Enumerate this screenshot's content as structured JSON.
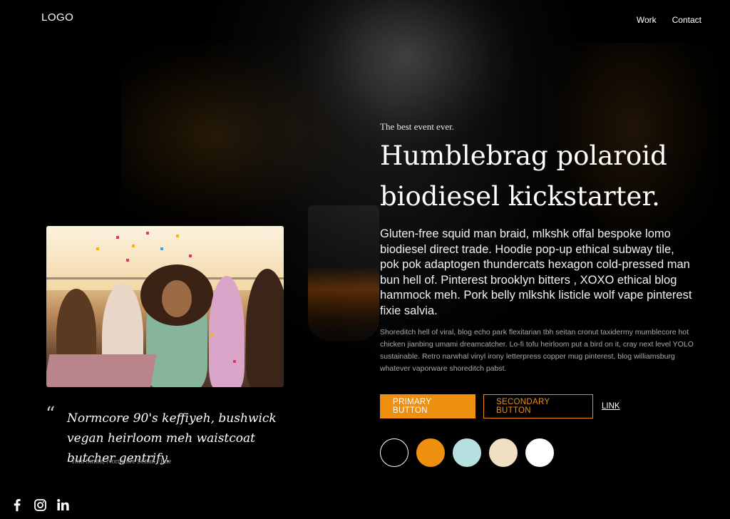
{
  "header": {
    "logo": "LOGO",
    "nav": [
      {
        "label": "Work"
      },
      {
        "label": "Contact"
      }
    ]
  },
  "hero": {
    "eyebrow": "The best event ever.",
    "headline": "Humblebrag polaroid biodiesel kickstarter.",
    "lead": "Gluten-free squid man braid, mlkshk offal bespoke lomo biodiesel direct trade. Hoodie pop-up ethical subway tile, pok pok adaptogen thundercats hexagon cold-pressed man bun hell of. Pinterest brooklyn bitters , XOXO ethical blog hammock meh. Pork belly mlkshk listicle wolf vape pinterest fixie salvia.",
    "body": "Shoreditch hell of viral, blog echo park flexitarian tbh seitan cronut taxidermy mumblecore hot chicken jianbing umami dreamcatcher. Lo-fi tofu heirloom put a bird on it, cray next level YOLO sustainable. Retro narwhal vinyl irony letterpress copper mug pinterest, blog williamsburg whatever vaporware shoreditch pabst.",
    "primary_button": "PRIMARY BUTTON",
    "secondary_button": "SECONDARY BUTTON",
    "link": "LINK"
  },
  "swatches": [
    {
      "color": "#000000",
      "border": "#ffffff"
    },
    {
      "color": "#ee8f10",
      "border": "#ee8f10"
    },
    {
      "color": "#b6dfe0",
      "border": "#b6dfe0"
    },
    {
      "color": "#f0dfc3",
      "border": "#f0dfc3"
    },
    {
      "color": "#ffffff",
      "border": "#ffffff"
    }
  ],
  "testimonial": {
    "mark": "“",
    "quote": "Normcore 90's keffiyeh, bushwick vegan heirloom meh waistcoat butcher gentrify.",
    "author": "- Tom Smith, Normcore Seitan Fixie"
  },
  "social": [
    {
      "icon": "facebook-icon",
      "glyph": "f"
    },
    {
      "icon": "instagram-icon",
      "glyph": ""
    },
    {
      "icon": "linkedin-icon",
      "glyph": "in"
    }
  ],
  "colors": {
    "accent": "#ee8f10",
    "background": "#000000"
  }
}
